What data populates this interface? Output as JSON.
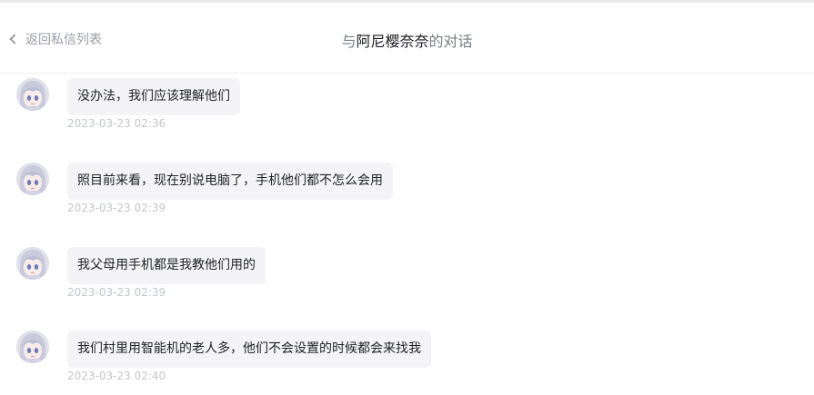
{
  "header": {
    "back_label": "返回私信列表",
    "back_icon": "chevron-left-icon",
    "title_prefix": "与",
    "title_name": "阿尼樱奈奈",
    "title_suffix": "的对话"
  },
  "messages": [
    {
      "text": "没办法，我们应该理解他们",
      "time": "2023-03-23 02:36"
    },
    {
      "text": "照目前来看，现在别说电脑了，手机他们都不怎么会用",
      "time": "2023-03-23 02:39"
    },
    {
      "text": "我父母用手机都是我教他们用的",
      "time": "2023-03-23 02:39"
    },
    {
      "text": "我们村里用智能机的老人多，他们不会设置的时候都会来找我",
      "time": "2023-03-23 02:40"
    }
  ],
  "colors": {
    "muted_text": "#9a9ca3",
    "title_name": "#18191c",
    "bubble_bg": "#f4f4f6",
    "timestamp": "#c4c6cc"
  }
}
